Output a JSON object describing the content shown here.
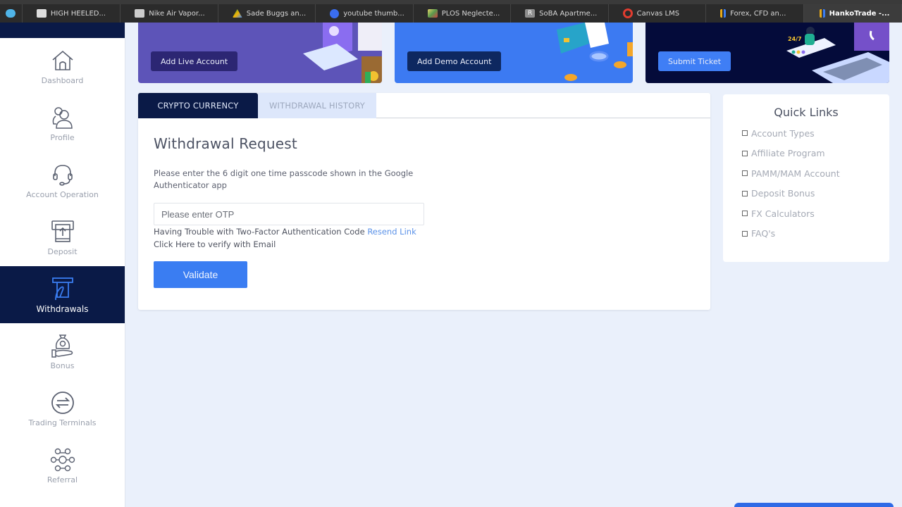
{
  "browser": {
    "tabs": [
      {
        "label": "",
        "icon": "cloud-icon",
        "color": "#4fb4e8"
      },
      {
        "label": "HIGH HEELED...",
        "icon": "wwd-icon",
        "color": "#dddddd"
      },
      {
        "label": "Nike Air Vapor...",
        "icon": "nike-icon",
        "color": "#cccccc"
      },
      {
        "label": "Sade Buggs an...",
        "icon": "drive-icon",
        "color": "#f4b400"
      },
      {
        "label": "youtube thumb...",
        "icon": "canva-icon",
        "color": "#3a6df0"
      },
      {
        "label": "PLOS Neglecte...",
        "icon": "plos-icon",
        "color": "#e5d46a"
      },
      {
        "label": "SoBA Apartme...",
        "icon": "r-icon",
        "color": "#8e8e8e"
      },
      {
        "label": "Canvas LMS",
        "icon": "canvas-icon",
        "color": "#e13c2f"
      },
      {
        "label": "Forex, CFD an...",
        "icon": "hanko-icon",
        "color": "#e6a91a"
      },
      {
        "label": "HankoTrade -...",
        "icon": "hanko-icon",
        "color": "#3a7df2",
        "active": true
      }
    ]
  },
  "sidebar": {
    "items": [
      {
        "label": "Dashboard",
        "icon": "home-icon"
      },
      {
        "label": "Profile",
        "icon": "profile-icon"
      },
      {
        "label": "Account Operation",
        "icon": "headset-icon"
      },
      {
        "label": "Deposit",
        "icon": "deposit-icon"
      },
      {
        "label": "Withdrawals",
        "icon": "withdraw-icon",
        "active": true
      },
      {
        "label": "Bonus",
        "icon": "money-bag-icon"
      },
      {
        "label": "Trading Terminals",
        "icon": "exchange-icon"
      },
      {
        "label": "Referral",
        "icon": "network-icon"
      }
    ]
  },
  "banners": {
    "live": {
      "button": "Add Live Account"
    },
    "demo": {
      "button": "Add Demo Account"
    },
    "support": {
      "button": "Submit Ticket",
      "badge": "24/7"
    }
  },
  "withdrawal": {
    "tabs": [
      "CRYPTO CURRENCY",
      "WITHDRAWAL HISTORY"
    ],
    "active_tab": "CRYPTO CURRENCY",
    "title": "Withdrawal Request",
    "description": "Please enter the 6 digit one time passcode shown in the Google Authenticator app",
    "otp": {
      "placeholder": "Please enter OTP",
      "value": ""
    },
    "help_text": "Having Trouble with Two-Factor Authentication Code",
    "resend_link": "Resend Link",
    "email_verify": "Click Here to verify with Email",
    "validate_button": "Validate"
  },
  "quick_links": {
    "title": "Quick Links",
    "items": [
      "Account Types",
      "Affiliate Program",
      "PAMM/MAM Account",
      "Deposit Bonus",
      "FX Calculators",
      "FAQ's"
    ]
  },
  "colors": {
    "navy": "#0a1a47",
    "accent_blue": "#3a7df2",
    "purple": "#5d54b8",
    "link": "#5b92e8"
  }
}
